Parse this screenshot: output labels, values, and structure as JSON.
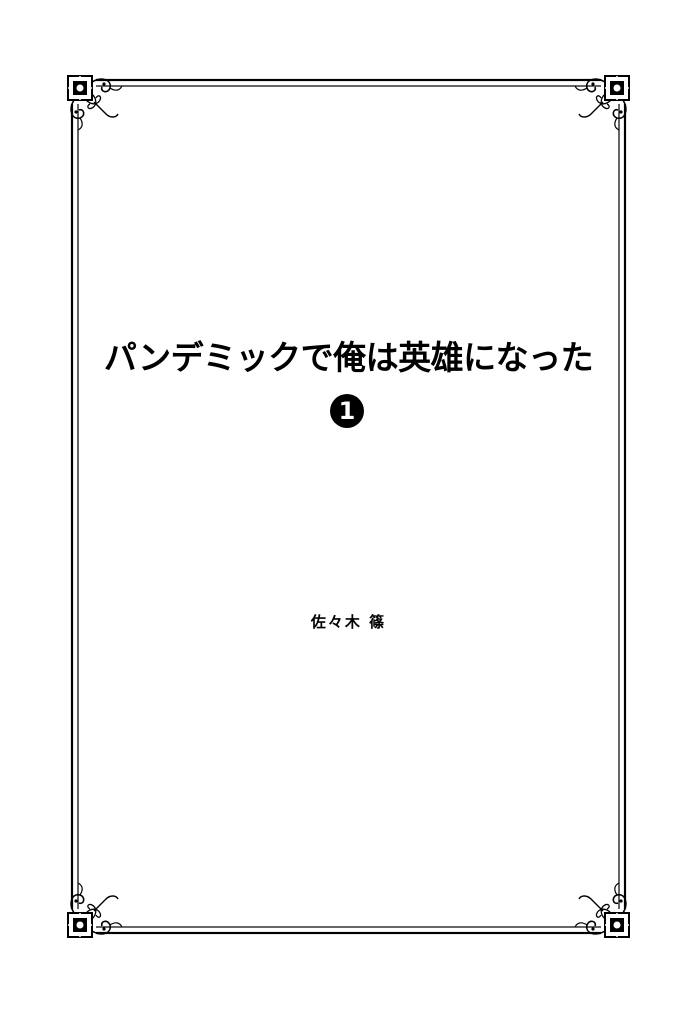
{
  "book": {
    "title": "パンデミックで俺は英雄になった",
    "volume": "1",
    "author": "佐々木 篠"
  },
  "icons": {
    "corner_ornament": "ornamental-corner-icon"
  }
}
